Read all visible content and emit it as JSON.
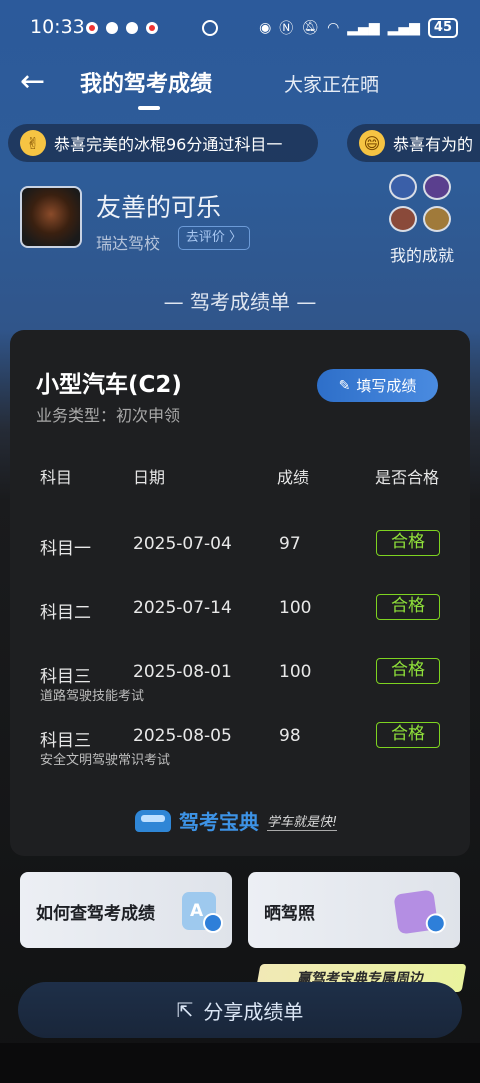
{
  "status_bar": {
    "time": "10:33",
    "battery": "45"
  },
  "nav": {
    "back_label": "←",
    "title": "我的驾考成绩",
    "tab2": "大家正在晒"
  },
  "ticker": [
    {
      "emoji": "✌",
      "text": "恭喜完美的冰棍96分通过科目一"
    },
    {
      "emoji": "😄",
      "text": "恭喜有为的"
    }
  ],
  "user": {
    "name": "友善的可乐",
    "school": "瑞达驾校",
    "rate_label": "去评价 〉",
    "achievement_label": "我的成就"
  },
  "section_title": "— 驾考成绩单 —",
  "card": {
    "license": "小型汽车(C2)",
    "business_type": "业务类型：初次申领",
    "fill_button": "填写成绩",
    "headers": [
      "科目",
      "日期",
      "成绩",
      "是否合格"
    ],
    "rows": [
      {
        "subject": "科目一",
        "date": "2025-07-04",
        "score": "97",
        "result": "合格",
        "note": ""
      },
      {
        "subject": "科目二",
        "date": "2025-07-14",
        "score": "100",
        "result": "合格",
        "note": ""
      },
      {
        "subject": "科目三",
        "date": "2025-08-01",
        "score": "100",
        "result": "合格",
        "note": "道路驾驶技能考试"
      },
      {
        "subject": "科目三",
        "date": "2025-08-05",
        "score": "98",
        "result": "合格",
        "note": "安全文明驾驶常识考试"
      }
    ],
    "brand_name": "驾考宝典",
    "brand_slogan": "学车就是快!"
  },
  "tiles": [
    {
      "label": "如何查驾考成绩",
      "icon_letter": "A"
    },
    {
      "label": "晒驾照"
    }
  ],
  "promo": "赢驾考宝典专属周边",
  "share_label": "分享成绩单",
  "colors": {
    "accent": "#3d8be3",
    "pass": "#7ed321",
    "card_bg": "#1e1f21"
  }
}
